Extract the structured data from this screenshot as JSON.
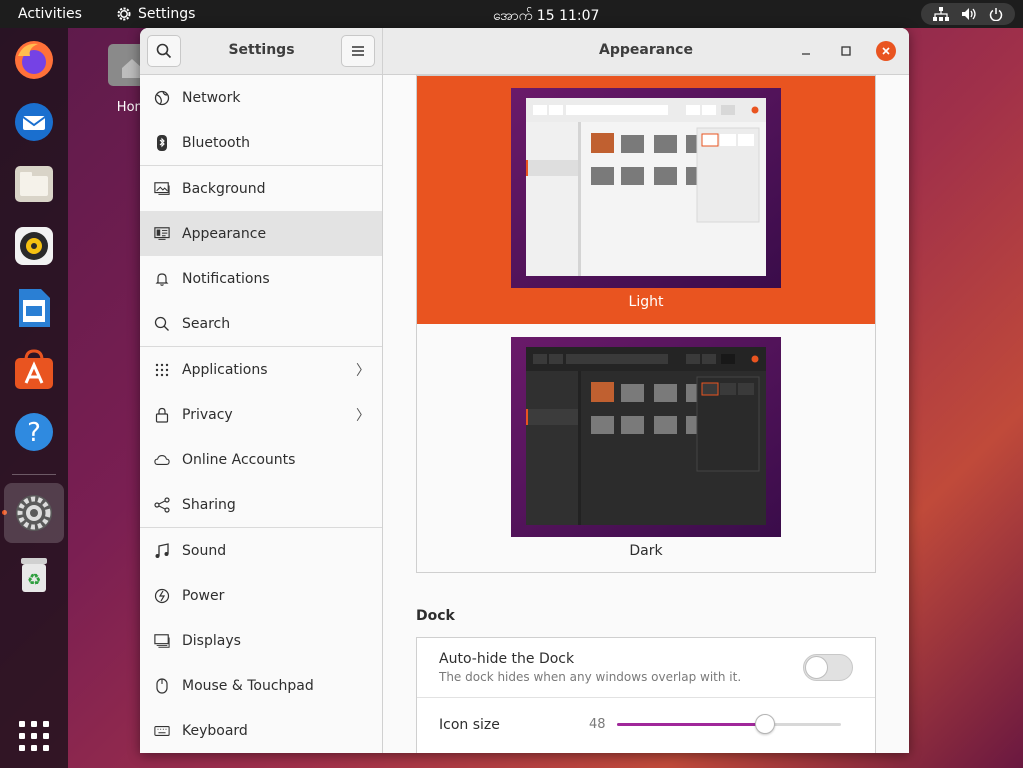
{
  "topbar": {
    "activities": "Activities",
    "app_name": "Settings",
    "clock": "အောက် 15  11:07",
    "app_icon": "gear-icon",
    "tray_icons": [
      "network-icon",
      "volume-icon",
      "power-icon"
    ]
  },
  "dock": {
    "apps": [
      "firefox-icon",
      "thunderbird-icon",
      "files-icon",
      "rhythmbox-icon",
      "libreoffice-writer-icon",
      "software-center-icon",
      "help-icon",
      "settings-icon",
      "trash-icon",
      "show-apps-icon"
    ],
    "active": "settings-icon"
  },
  "desktop": {
    "home_label": "Hom"
  },
  "window": {
    "sidebar_title": "Settings",
    "panel_title": "Appearance",
    "minimize": "_",
    "maximize": "□",
    "close": "✕"
  },
  "sidebar": {
    "items": [
      {
        "label": "Network",
        "icon": "globe-icon"
      },
      {
        "label": "Bluetooth",
        "icon": "bluetooth-icon"
      },
      {
        "label": "Background",
        "icon": "background-icon"
      },
      {
        "label": "Appearance",
        "icon": "appearance-icon",
        "selected": true
      },
      {
        "label": "Notifications",
        "icon": "bell-icon"
      },
      {
        "label": "Search",
        "icon": "search-icon"
      },
      {
        "label": "Applications",
        "icon": "apps-grid-icon",
        "chevron": "〉"
      },
      {
        "label": "Privacy",
        "icon": "lock-icon",
        "chevron": "〉"
      },
      {
        "label": "Online Accounts",
        "icon": "cloud-icon"
      },
      {
        "label": "Sharing",
        "icon": "share-icon"
      },
      {
        "label": "Sound",
        "icon": "music-note-icon"
      },
      {
        "label": "Power",
        "icon": "power-icon"
      },
      {
        "label": "Displays",
        "icon": "display-icon"
      },
      {
        "label": "Mouse & Touchpad",
        "icon": "mouse-icon"
      },
      {
        "label": "Keyboard",
        "icon": "keyboard-icon"
      }
    ]
  },
  "appearance": {
    "themes": [
      {
        "label": "Light",
        "selected": true
      },
      {
        "label": "Dark",
        "selected": false
      }
    ],
    "dock_heading": "Dock",
    "autohide": {
      "title": "Auto-hide the Dock",
      "subtitle": "The dock hides when any windows overlap with it.",
      "enabled": false
    },
    "icon_size": {
      "title": "Icon size",
      "value": "48",
      "fraction": 0.66
    }
  },
  "colors": {
    "accent": "#e95420",
    "slider": "#a0289a",
    "topbar": "#1d1d1d"
  }
}
